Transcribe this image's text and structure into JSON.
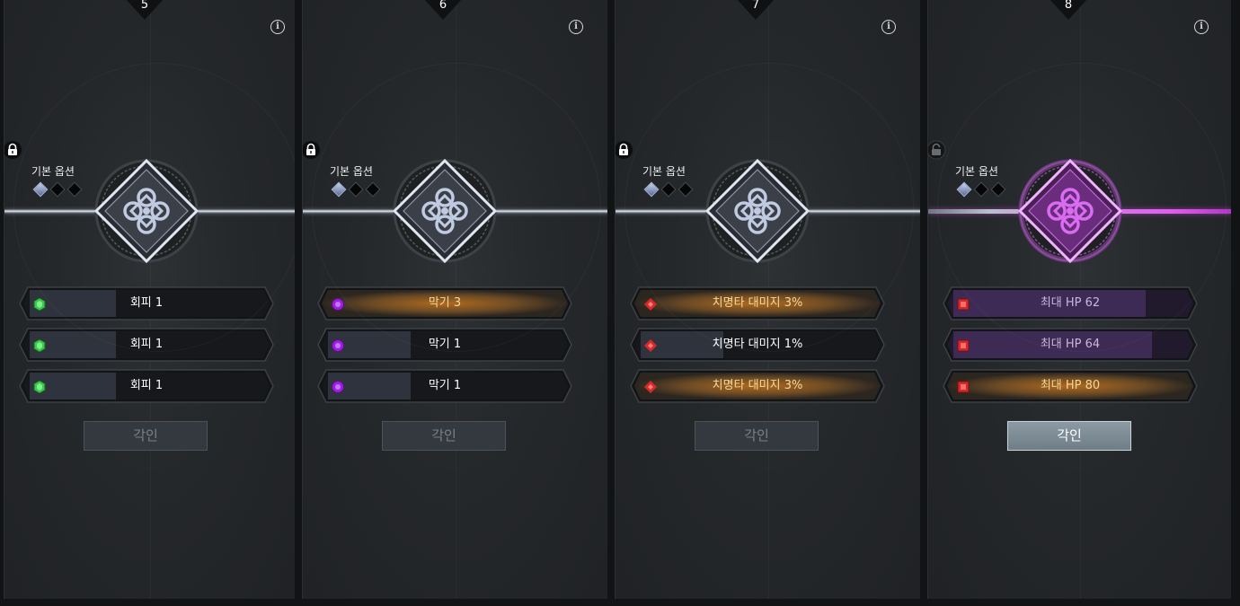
{
  "panels": [
    {
      "number": "5",
      "option_label": "기본 옵션",
      "locked": true,
      "emblem_color": "#c0cae0",
      "rail_style": "silver",
      "rows": [
        {
          "text": "회피 1",
          "style": "dark",
          "icon": "green-hexagon-icon",
          "icon_color": "#3bc94a"
        },
        {
          "text": "회피 1",
          "style": "dark",
          "icon": "green-hexagon-icon",
          "icon_color": "#3bc94a"
        },
        {
          "text": "회피 1",
          "style": "dark",
          "icon": "green-hexagon-icon",
          "icon_color": "#3bc94a"
        }
      ],
      "button_label": "각인",
      "button_active": false
    },
    {
      "number": "6",
      "option_label": "기본 옵션",
      "locked": true,
      "emblem_color": "#c0cae0",
      "rail_style": "silver",
      "rows": [
        {
          "text": "막기 3",
          "style": "orange",
          "icon": "purple-circle-icon",
          "icon_color": "#9c1fe0"
        },
        {
          "text": "막기 1",
          "style": "dark",
          "icon": "purple-circle-icon",
          "icon_color": "#9c1fe0"
        },
        {
          "text": "막기 1",
          "style": "dark",
          "icon": "purple-circle-icon",
          "icon_color": "#9c1fe0"
        }
      ],
      "button_label": "각인",
      "button_active": false
    },
    {
      "number": "7",
      "option_label": "기본 옵션",
      "locked": true,
      "emblem_color": "#c0cae0",
      "rail_style": "silver",
      "rows": [
        {
          "text": "치명타 대미지 3%",
          "style": "orange",
          "icon": "red-diamond-icon",
          "icon_color": "#d62a2a"
        },
        {
          "text": "치명타 대미지 1%",
          "style": "dark",
          "icon": "red-diamond-icon",
          "icon_color": "#d62a2a"
        },
        {
          "text": "치명타 대미지 3%",
          "style": "orange",
          "icon": "red-diamond-icon",
          "icon_color": "#d62a2a"
        }
      ],
      "button_label": "각인",
      "button_active": false
    },
    {
      "number": "8",
      "option_label": "기본 옵션",
      "locked": false,
      "emblem_color": "#d96cf0",
      "rail_style": "purple",
      "rows": [
        {
          "text": "최대 HP 62",
          "style": "purple",
          "icon": "red-square-icon",
          "icon_color": "#d12a2a"
        },
        {
          "text": "최대 HP 64",
          "style": "purple",
          "icon": "red-square-icon",
          "icon_color": "#d12a2a"
        },
        {
          "text": "최대 HP 80",
          "style": "orange",
          "icon": "red-square-icon",
          "icon_color": "#d12a2a"
        }
      ],
      "button_label": "각인",
      "button_active": true
    }
  ],
  "colors": {
    "background": "#1a1c1e",
    "highlight_orange": "#f6d89a",
    "highlight_purple": "#c9b7dc",
    "active_rail": "#e35cf0"
  }
}
